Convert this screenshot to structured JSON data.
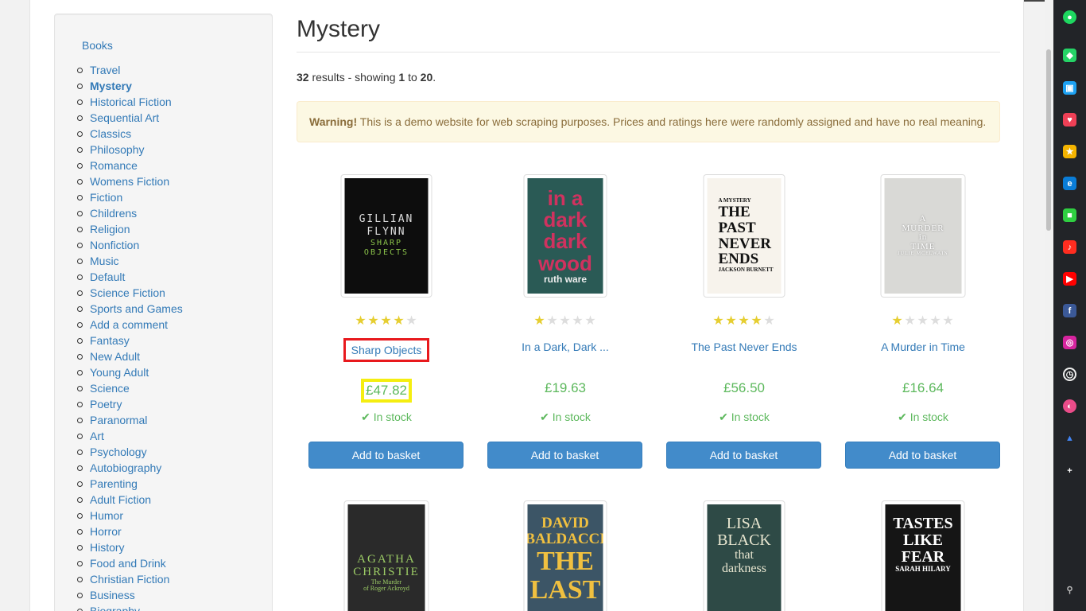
{
  "sidebar": {
    "root_label": "Books",
    "categories": [
      "Travel",
      "Mystery",
      "Historical Fiction",
      "Sequential Art",
      "Classics",
      "Philosophy",
      "Romance",
      "Womens Fiction",
      "Fiction",
      "Childrens",
      "Religion",
      "Nonfiction",
      "Music",
      "Default",
      "Science Fiction",
      "Sports and Games",
      "Add a comment",
      "Fantasy",
      "New Adult",
      "Young Adult",
      "Science",
      "Poetry",
      "Paranormal",
      "Art",
      "Psychology",
      "Autobiography",
      "Parenting",
      "Adult Fiction",
      "Humor",
      "Horror",
      "History",
      "Food and Drink",
      "Christian Fiction",
      "Business",
      "Biography"
    ],
    "active_category": "Mystery"
  },
  "main": {
    "title": "Mystery",
    "results": {
      "total": "32",
      "text_mid": " results - showing ",
      "from": "1",
      "to_word": " to ",
      "to": "20",
      "end": "."
    },
    "warning": {
      "label": "Warning!",
      "text": " This is a demo website for web scraping purposes. Prices and ratings here were randomly assigned and have no real meaning."
    }
  },
  "products": [
    {
      "title": "Sharp Objects",
      "rating": 4,
      "price": "£47.82",
      "stock": "In stock",
      "button": "Add to basket",
      "cover_lines": [
        "GILLIAN",
        "FLYNN",
        "SHARP",
        "OBJECTS"
      ]
    },
    {
      "title": "In a Dark, Dark ...",
      "rating": 1,
      "price": "£19.63",
      "stock": "In stock",
      "button": "Add to basket",
      "cover_lines": [
        "in a",
        "dark",
        "dark",
        "wood",
        "ruth ware"
      ]
    },
    {
      "title": "The Past Never Ends",
      "rating": 4,
      "price": "£56.50",
      "stock": "In stock",
      "button": "Add to basket",
      "cover_lines": [
        "A MYSTERY",
        "THE",
        "PAST",
        "NEVER",
        "ENDS",
        "JACKSON BURNETT"
      ]
    },
    {
      "title": "A Murder in Time",
      "rating": 1,
      "price": "£16.64",
      "stock": "In stock",
      "button": "Add to basket",
      "cover_lines": [
        "A",
        "MURDER",
        "in",
        "TIME",
        "JULIE MCELWAIN"
      ]
    }
  ],
  "products_row2": [
    {
      "cover_lines": [
        "AGATHA",
        "CHRISTIE",
        "The Murder",
        "of Roger Ackroyd"
      ]
    },
    {
      "cover_lines": [
        "DAVID",
        "BALDACCI",
        "THE",
        "LAST"
      ]
    },
    {
      "cover_lines": [
        "LISA",
        "BLACK",
        "that",
        "darkness"
      ]
    },
    {
      "cover_lines": [
        "TASTES",
        "LIKE",
        "FEAR",
        "SARAH HILARY"
      ]
    }
  ],
  "colors": {
    "link": "#337ab7",
    "price": "#5cb85c",
    "star": "#E6CE31",
    "button": "#428bca",
    "warning_bg": "#fcf8e3",
    "title_highlight": "#e8191d",
    "price_highlight": "#f5ee11"
  },
  "dock_icons": [
    "app-icon",
    "chat-icon",
    "mail-icon",
    "pocket-icon",
    "star-icon",
    "edge-icon",
    "green-icon",
    "music-icon",
    "youtube-icon",
    "facebook-icon",
    "instagram-icon",
    "clock-icon",
    "dribbble-icon",
    "drive-icon",
    "add-icon",
    "pin-icon"
  ]
}
